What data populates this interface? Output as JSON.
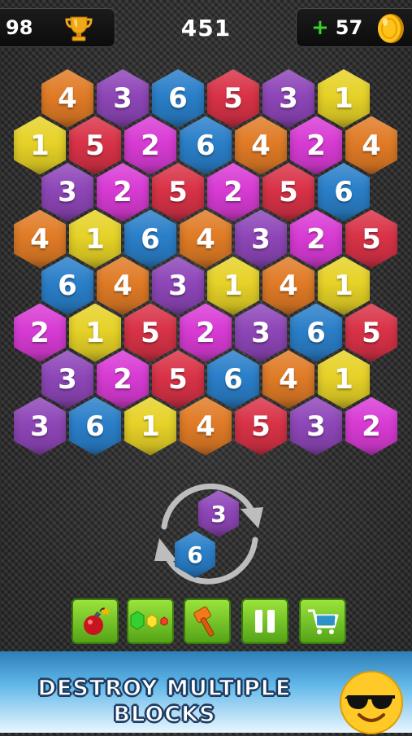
{
  "header": {
    "best_score": "98",
    "score": "451",
    "coins_prefix": "+",
    "coins": "57"
  },
  "board": {
    "rows": [
      [
        {
          "v": "4",
          "c": "orange"
        },
        {
          "v": "3",
          "c": "purple"
        },
        {
          "v": "6",
          "c": "blue"
        },
        {
          "v": "5",
          "c": "red"
        },
        {
          "v": "3",
          "c": "purple"
        },
        {
          "v": "1",
          "c": "yellow"
        }
      ],
      [
        {
          "v": "1",
          "c": "yellow"
        },
        {
          "v": "5",
          "c": "red"
        },
        {
          "v": "2",
          "c": "magenta"
        },
        {
          "v": "6",
          "c": "blue"
        },
        {
          "v": "4",
          "c": "orange"
        },
        {
          "v": "2",
          "c": "magenta"
        },
        {
          "v": "4",
          "c": "orange"
        }
      ],
      [
        {
          "v": "3",
          "c": "purple"
        },
        {
          "v": "2",
          "c": "magenta"
        },
        {
          "v": "5",
          "c": "red"
        },
        {
          "v": "2",
          "c": "magenta"
        },
        {
          "v": "5",
          "c": "red"
        },
        {
          "v": "6",
          "c": "blue"
        }
      ],
      [
        {
          "v": "4",
          "c": "orange"
        },
        {
          "v": "1",
          "c": "yellow"
        },
        {
          "v": "6",
          "c": "blue"
        },
        {
          "v": "4",
          "c": "orange"
        },
        {
          "v": "3",
          "c": "purple"
        },
        {
          "v": "2",
          "c": "magenta"
        },
        {
          "v": "5",
          "c": "red"
        }
      ],
      [
        {
          "v": "6",
          "c": "blue"
        },
        {
          "v": "4",
          "c": "orange"
        },
        {
          "v": "3",
          "c": "purple"
        },
        {
          "v": "1",
          "c": "yellow"
        },
        {
          "v": "4",
          "c": "orange"
        },
        {
          "v": "1",
          "c": "yellow"
        }
      ],
      [
        {
          "v": "2",
          "c": "magenta"
        },
        {
          "v": "1",
          "c": "yellow"
        },
        {
          "v": "5",
          "c": "red"
        },
        {
          "v": "2",
          "c": "magenta"
        },
        {
          "v": "3",
          "c": "purple"
        },
        {
          "v": "6",
          "c": "blue"
        },
        {
          "v": "5",
          "c": "red"
        }
      ],
      [
        {
          "v": "3",
          "c": "purple"
        },
        {
          "v": "2",
          "c": "magenta"
        },
        {
          "v": "5",
          "c": "red"
        },
        {
          "v": "6",
          "c": "blue"
        },
        {
          "v": "4",
          "c": "orange"
        },
        {
          "v": "1",
          "c": "yellow"
        }
      ],
      [
        {
          "v": "3",
          "c": "purple"
        },
        {
          "v": "6",
          "c": "blue"
        },
        {
          "v": "1",
          "c": "yellow"
        },
        {
          "v": "4",
          "c": "orange"
        },
        {
          "v": "5",
          "c": "red"
        },
        {
          "v": "3",
          "c": "purple"
        },
        {
          "v": "2",
          "c": "magenta"
        }
      ]
    ]
  },
  "colors": {
    "orange": "#e07b26",
    "purple": "#8e46b8",
    "blue": "#2a7fc9",
    "red": "#d93247",
    "yellow": "#e6d227",
    "magenta": "#d83bd4"
  },
  "next_piece": {
    "top": {
      "v": "3",
      "c": "purple"
    },
    "bottom": {
      "v": "6",
      "c": "blue"
    }
  },
  "toolbar": {
    "items": [
      {
        "name": "bomb-button",
        "icon": "bomb-icon"
      },
      {
        "name": "hex-shape-button",
        "icon": "hex-shapes-icon"
      },
      {
        "name": "hammer-button",
        "icon": "hammer-icon"
      },
      {
        "name": "pause-button",
        "icon": "pause-icon"
      },
      {
        "name": "shop-button",
        "icon": "shopping-cart-icon"
      }
    ]
  },
  "banner": {
    "line1": "DESTROY MULTIPLE",
    "line2": "BLOCKS",
    "emoji": "sunglasses-emoji-icon"
  }
}
